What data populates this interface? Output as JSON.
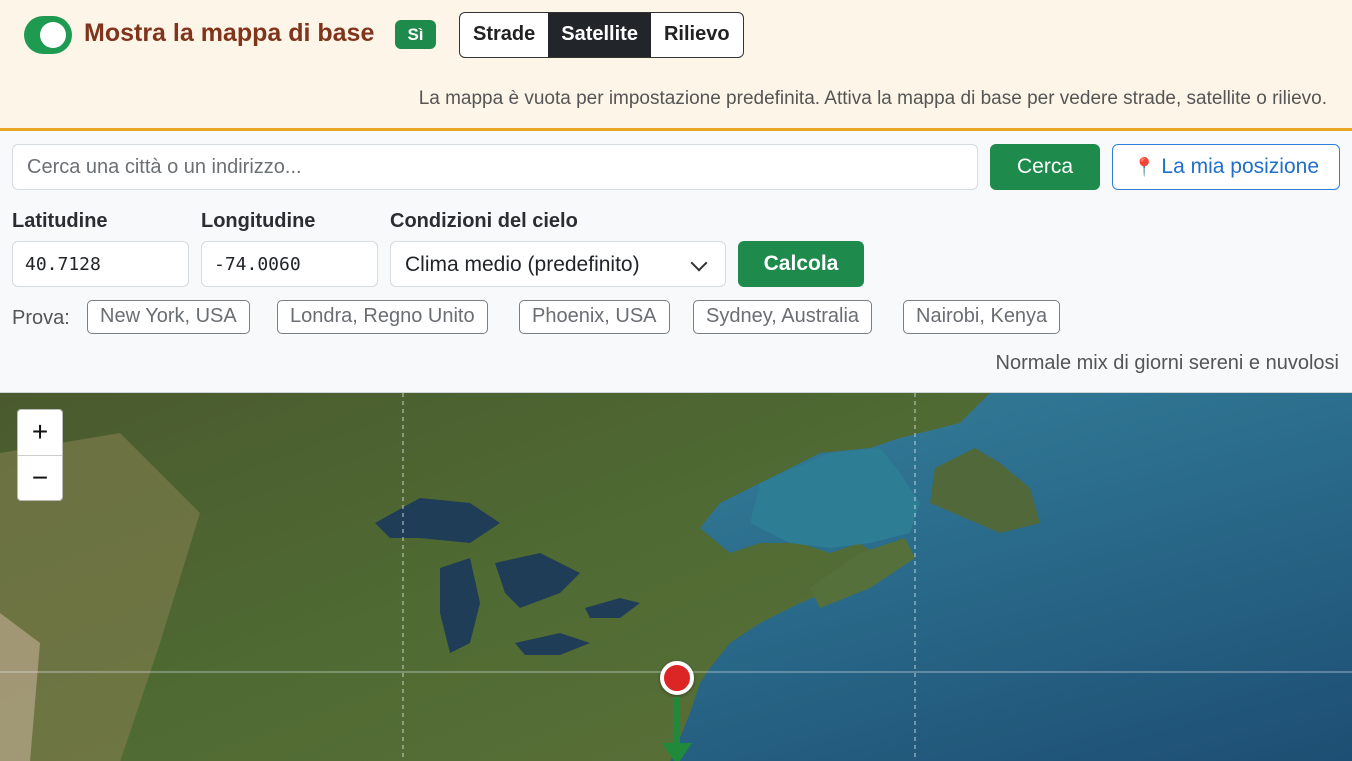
{
  "banner": {
    "toggle_on": true,
    "title": "Mostra la mappa di base",
    "badge": "Sì",
    "map_types": [
      "Strade",
      "Satellite",
      "Rilievo"
    ],
    "active_map_type": "Satellite",
    "note": "La mappa è vuota per impostazione predefinita. Attiva la mappa di base per vedere strade, satellite o rilievo."
  },
  "search": {
    "placeholder": "Cerca una città o un indirizzo...",
    "button": "Cerca",
    "location_button": "La mia posizione",
    "location_icon": "pin-icon"
  },
  "form": {
    "lat_label": "Latitudine",
    "lat_value": "40.7128",
    "lon_label": "Longitudine",
    "lon_value": "-74.0060",
    "sky_label": "Condizioni del cielo",
    "sky_value": "Clima medio (predefinito)",
    "calc_button": "Calcola"
  },
  "presets": {
    "label": "Prova:",
    "items": [
      "New York, USA",
      "Londra, Regno Unito",
      "Phoenix, USA",
      "Sydney, Australia",
      "Nairobi, Kenya"
    ]
  },
  "sky_description": "Normale mix di giorni sereni e nuvolosi",
  "map": {
    "zoom_in": "+",
    "zoom_out": "−",
    "marker_color": "#dc2626",
    "arrow_color": "#1e8a3a"
  }
}
